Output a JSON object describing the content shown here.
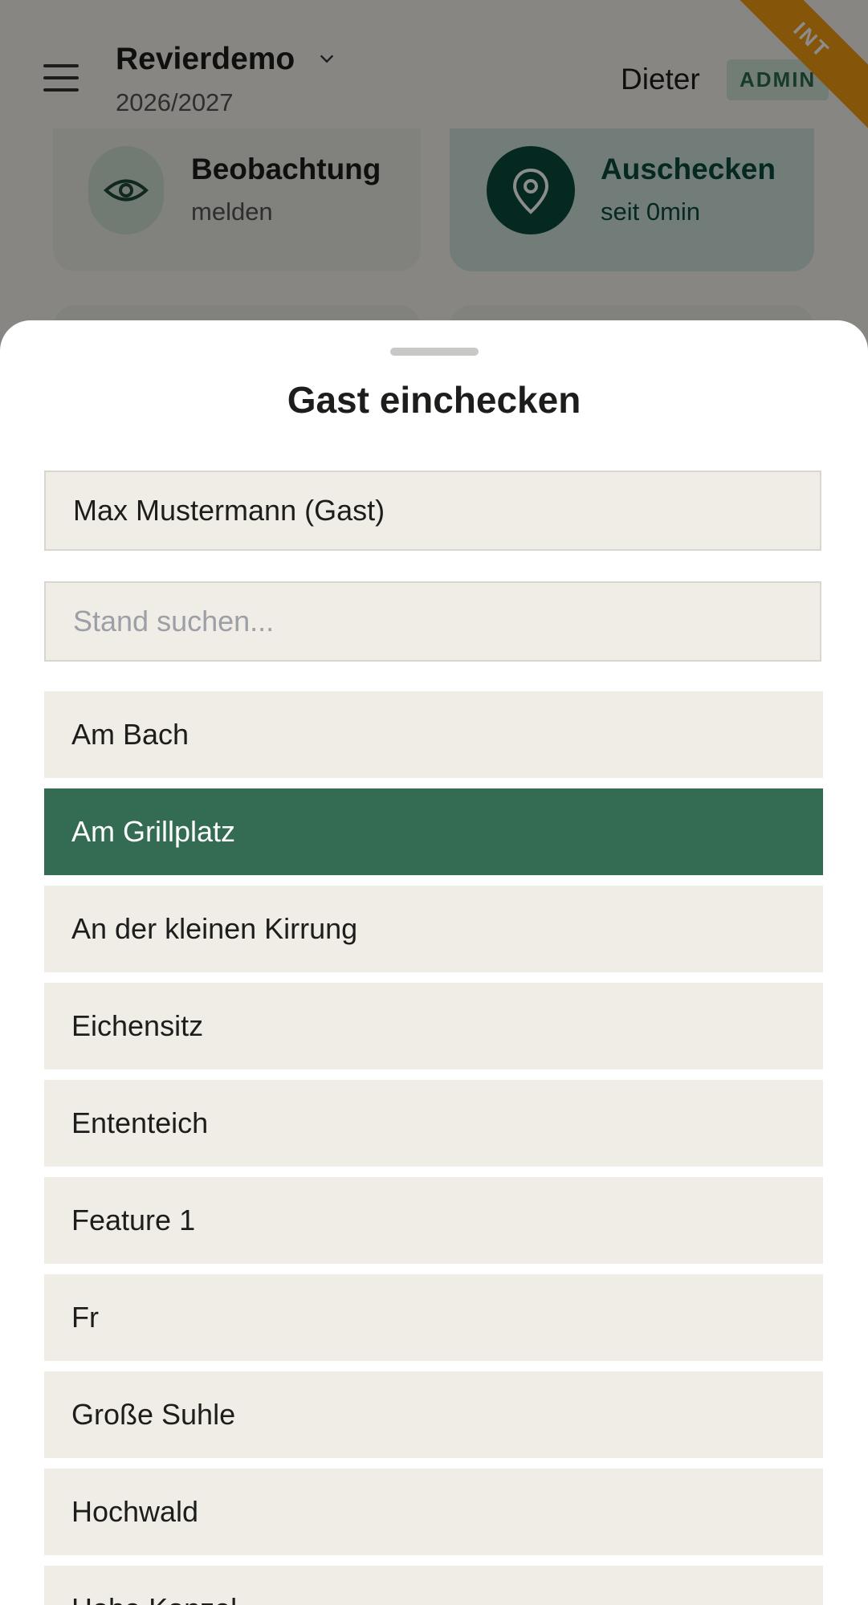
{
  "header": {
    "revier": "Revierdemo",
    "season": "2026/2027",
    "user": "Dieter",
    "role_badge": "ADMIN",
    "env_ribbon": "INT"
  },
  "cards": [
    {
      "title": "Beobachtung",
      "subtitle": "melden",
      "icon": "eye-icon"
    },
    {
      "title": "Auschecken",
      "subtitle": "seit 0min",
      "icon": "location-pin-icon"
    }
  ],
  "sheet": {
    "title": "Gast einchecken",
    "guest_value": "Max Mustermann (Gast)",
    "search_placeholder": "Stand suchen...",
    "stands": [
      {
        "label": "Am Bach",
        "selected": false
      },
      {
        "label": "Am Grillplatz",
        "selected": true
      },
      {
        "label": "An der kleinen Kirrung",
        "selected": false
      },
      {
        "label": "Eichensitz",
        "selected": false
      },
      {
        "label": "Ententeich",
        "selected": false
      },
      {
        "label": "Feature 1",
        "selected": false
      },
      {
        "label": "Fr",
        "selected": false
      },
      {
        "label": "Große Suhle",
        "selected": false
      },
      {
        "label": "Hochwald",
        "selected": false
      },
      {
        "label": "Hohe Kanzel",
        "selected": false
      }
    ]
  },
  "colors": {
    "accent": "#336c53",
    "ribbon": "#f39c12",
    "item_bg": "#f0ede6"
  }
}
